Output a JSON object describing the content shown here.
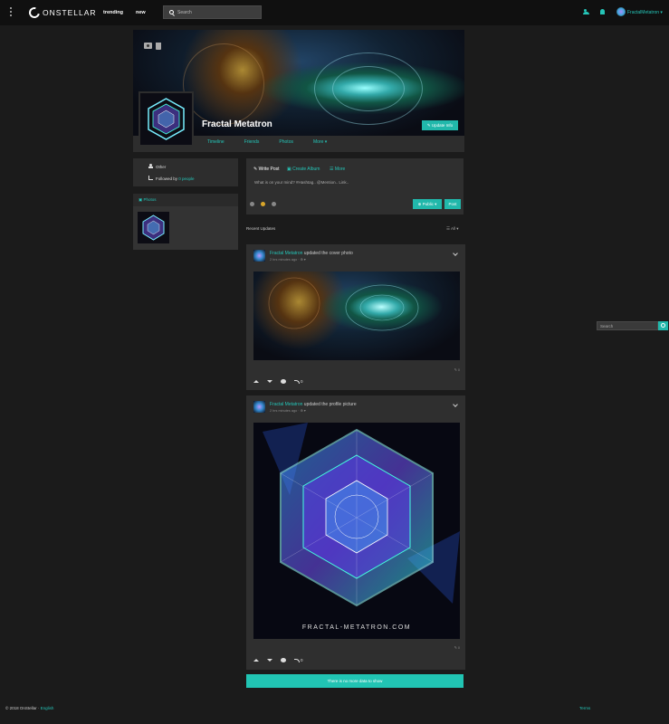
{
  "nav": {
    "logo_text": "ONSTELLAR",
    "links": [
      "trending",
      "new"
    ],
    "search_placeholder": "Search",
    "user_name": "FractalMetatron ▾"
  },
  "profile": {
    "name": "Fractal Metatron",
    "update_button": "✎ Update Info",
    "tabs": [
      "Timeline",
      "Friends",
      "Photos",
      "More ▾"
    ],
    "about": [
      "Other",
      "Followed by"
    ],
    "followed_count": "0 people",
    "photos_label": "Photos"
  },
  "composer": {
    "tabs": [
      "Write Post",
      "Create Album",
      "More"
    ],
    "placeholder": "What is on your mind? #Hashtag.. @Mention.. Link..",
    "public_label": "⊕ Public ▾",
    "post_label": "Post"
  },
  "feed": {
    "recent_label": "Recent Updates",
    "filter_label": "All ▾",
    "posts": [
      {
        "author": "Fractal Metatron",
        "action": "updated the cover photo",
        "time": "2 hrs minutes ago",
        "meta": "",
        "comments": "0",
        "shares": "0"
      },
      {
        "author": "Fractal Metatron",
        "action": "updated the profile picture",
        "time": "2 hrs minutes ago",
        "meta": "",
        "comments": "0",
        "shares": "0",
        "caption": "FRACTAL-METATRON.COM"
      }
    ],
    "no_more": "There is no more data to show"
  },
  "sidebar": {
    "search_placeholder": "Search"
  },
  "footer": {
    "copyright": "© 2018 OnStellar · ",
    "language": "English",
    "right_link": "Terms"
  }
}
